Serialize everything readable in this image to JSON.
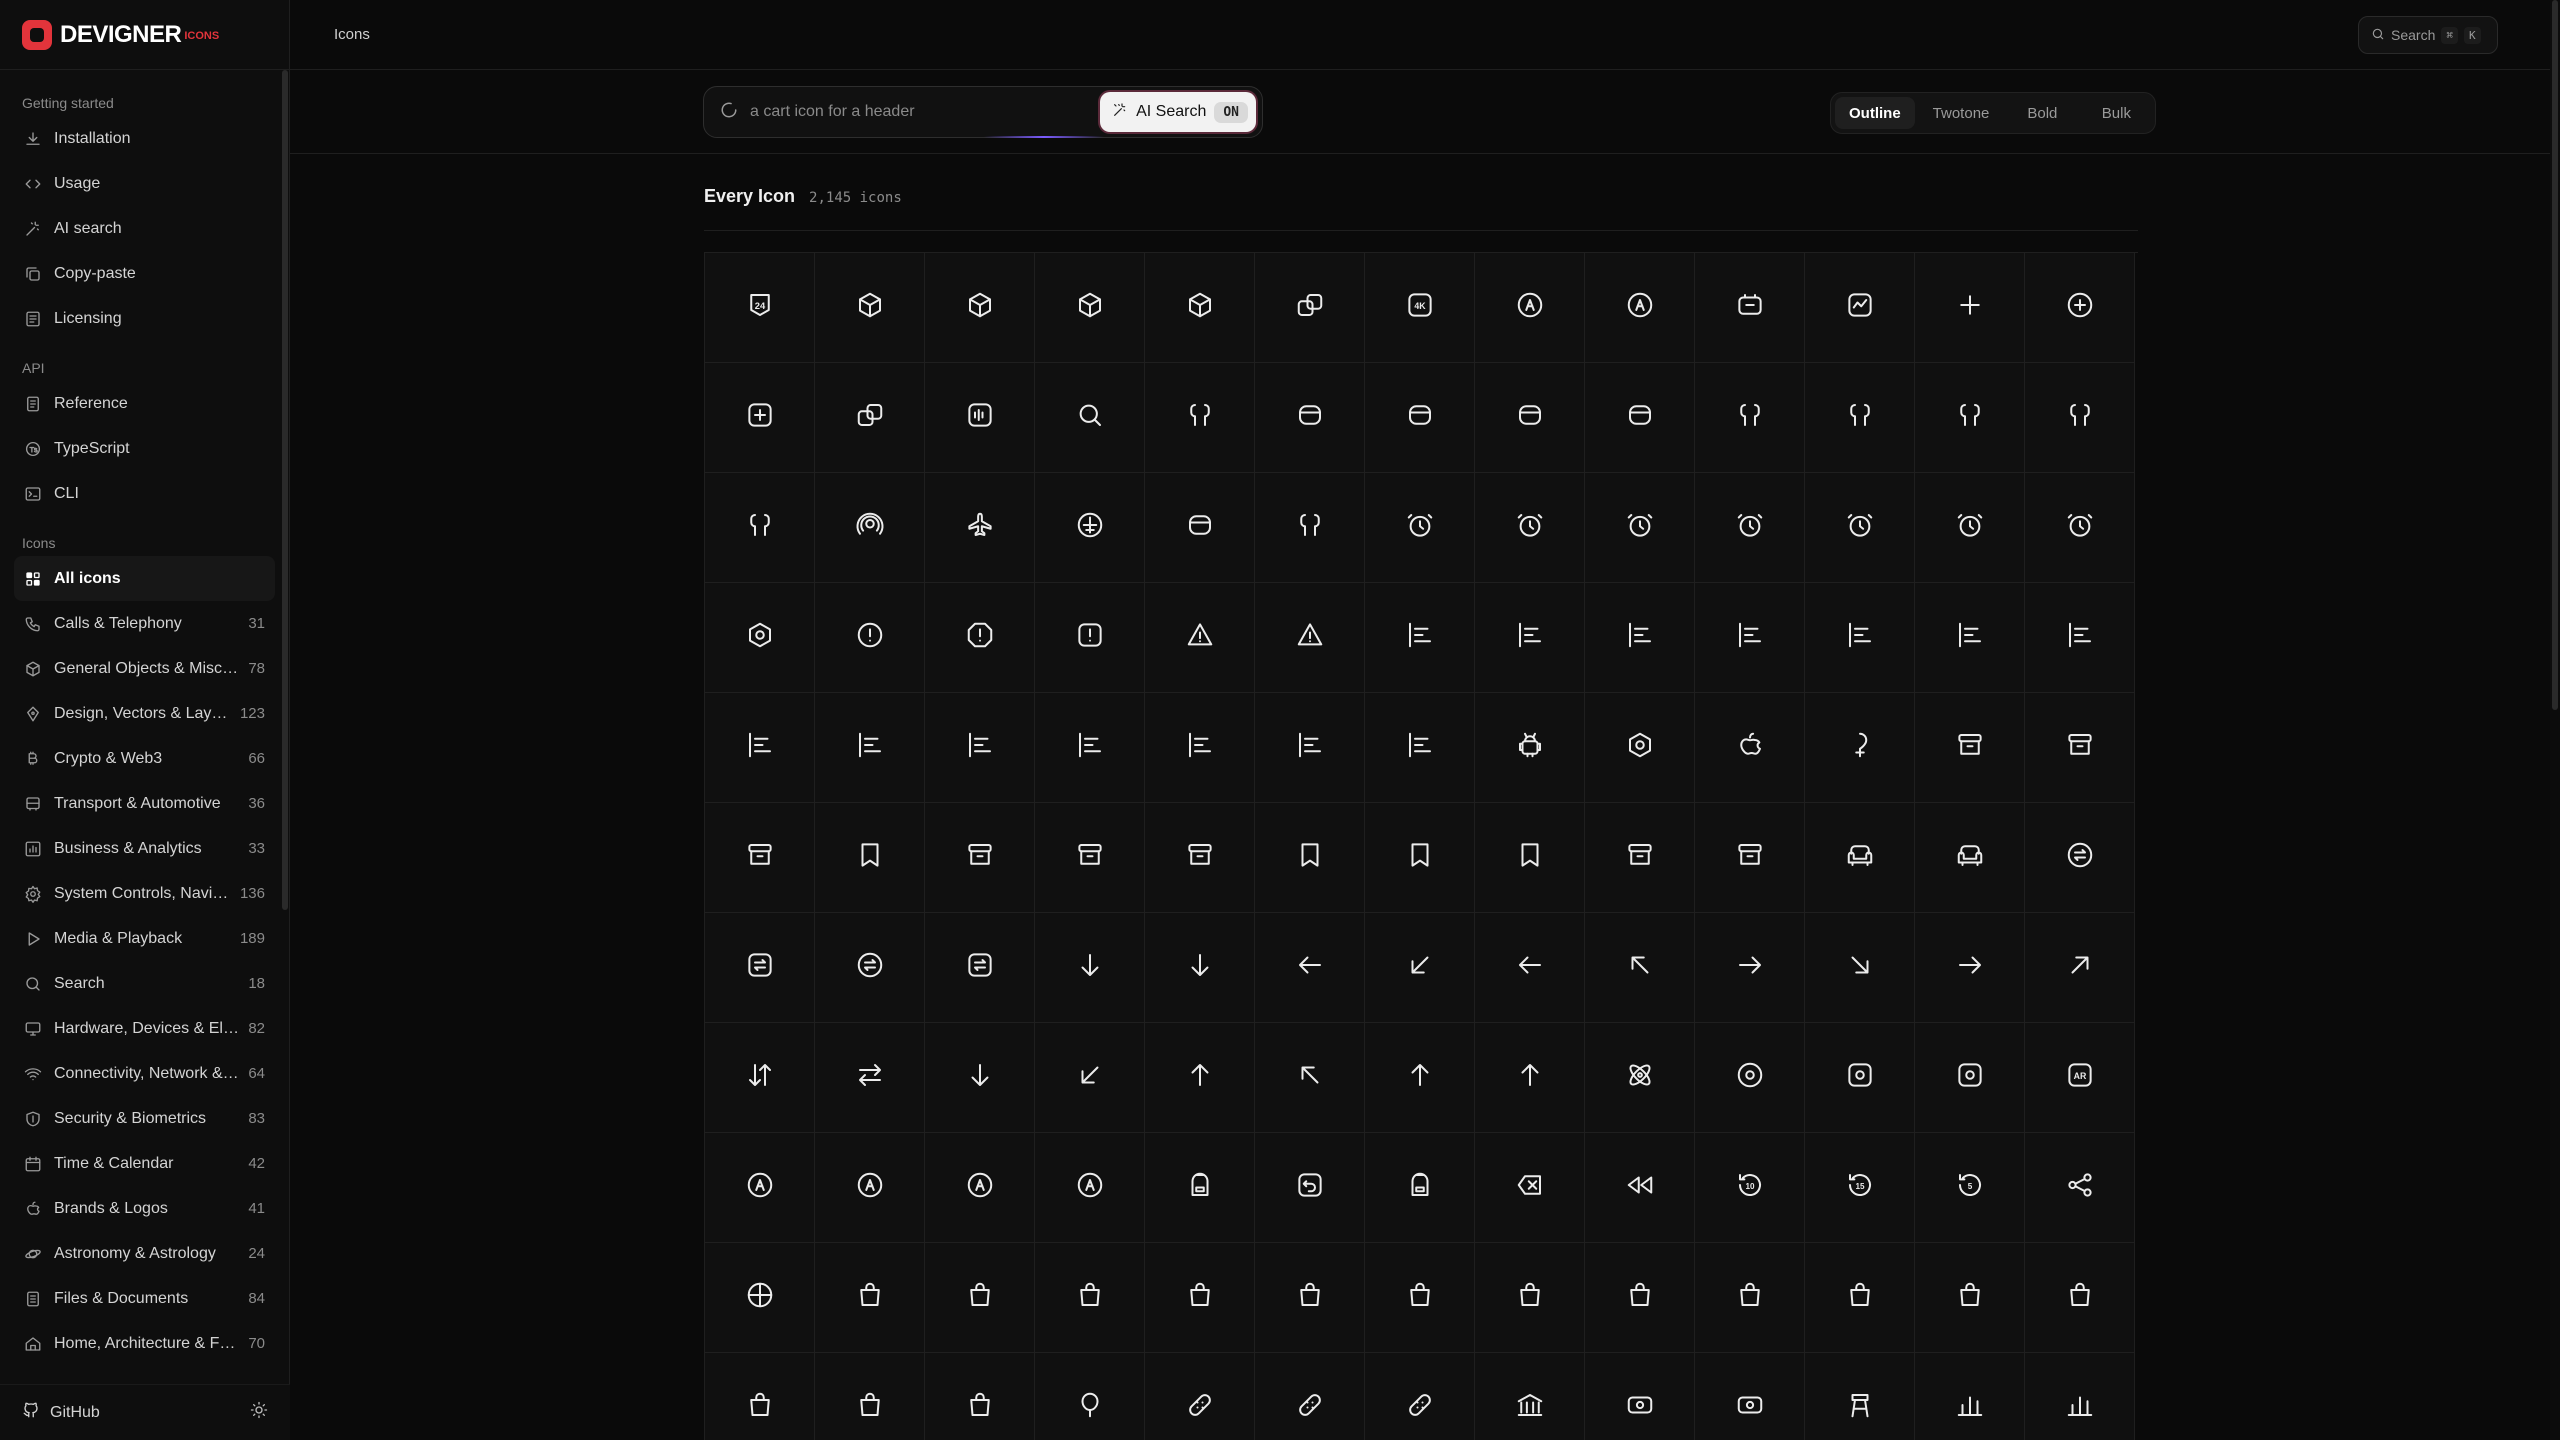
{
  "app": {
    "logo_text": "DEVIGNER",
    "logo_sub": "ICONS",
    "accent": "#e2343b"
  },
  "topbar": {
    "breadcrumb": "Icons",
    "search_label": "Search",
    "search_kbd_1": "⌘",
    "search_kbd_2": "K"
  },
  "sidebar": {
    "groups": [
      {
        "heading": "Getting started",
        "items": [
          {
            "label": "Installation",
            "icon": "download-icon"
          },
          {
            "label": "Usage",
            "icon": "code-icon"
          },
          {
            "label": "AI search",
            "icon": "sparkle-icon"
          },
          {
            "label": "Copy-paste",
            "icon": "copy-icon"
          },
          {
            "label": "Licensing",
            "icon": "license-icon"
          }
        ]
      },
      {
        "heading": "API",
        "items": [
          {
            "label": "Reference",
            "icon": "document-icon"
          },
          {
            "label": "TypeScript",
            "icon": "typescript-icon"
          },
          {
            "label": "CLI",
            "icon": "terminal-icon"
          }
        ]
      },
      {
        "heading": "Icons",
        "items": [
          {
            "label": "All icons",
            "icon": "grid-icon",
            "active": true
          },
          {
            "label": "Calls & Telephony",
            "count": "31",
            "icon": "phone-icon"
          },
          {
            "label": "General Objects & Miscellaneous",
            "count": "78",
            "icon": "box-icon"
          },
          {
            "label": "Design, Vectors & Layout",
            "count": "123",
            "icon": "pen-icon"
          },
          {
            "label": "Crypto & Web3",
            "count": "66",
            "icon": "bitcoin-icon"
          },
          {
            "label": "Transport & Automotive",
            "count": "36",
            "icon": "bus-icon"
          },
          {
            "label": "Business & Analytics",
            "count": "33",
            "icon": "chart-icon"
          },
          {
            "label": "System Controls, Navigation",
            "count": "136",
            "icon": "gear-icon"
          },
          {
            "label": "Media & Playback",
            "count": "189",
            "icon": "play-icon"
          },
          {
            "label": "Search",
            "count": "18",
            "icon": "search-icon"
          },
          {
            "label": "Hardware, Devices & Electronics",
            "count": "82",
            "icon": "monitor-icon"
          },
          {
            "label": "Connectivity, Network & Wireless",
            "count": "64",
            "icon": "wifi-icon"
          },
          {
            "label": "Security & Biometrics",
            "count": "83",
            "icon": "shield-icon"
          },
          {
            "label": "Time & Calendar",
            "count": "42",
            "icon": "calendar-icon"
          },
          {
            "label": "Brands & Logos",
            "count": "41",
            "icon": "apple-icon"
          },
          {
            "label": "Astronomy & Astrology",
            "count": "24",
            "icon": "planet-icon"
          },
          {
            "label": "Files & Documents",
            "count": "84",
            "icon": "file-icon"
          },
          {
            "label": "Home, Architecture & Furniture",
            "count": "70",
            "icon": "home-icon"
          }
        ]
      }
    ],
    "footer": {
      "label": "GitHub"
    }
  },
  "toolbar": {
    "ai_placeholder": "a cart icon for a header",
    "ai_button": "AI Search",
    "ai_state": "ON",
    "styles": [
      "Outline",
      "Twotone",
      "Bold",
      "Bulk"
    ],
    "selected_style": "Outline"
  },
  "section": {
    "title": "Every Icon",
    "count": "2,145 icons"
  },
  "icons": [
    "24-hours-icon",
    "cube-icon",
    "cube-rotate-icon",
    "cube-hexagon-icon",
    "box-3d-icon",
    "boxes-icon",
    "4k-icon",
    "accessibility-a-icon",
    "accessibility-icon",
    "camera-battery-icon",
    "activity-icon",
    "plus-icon",
    "plus-circle-icon",
    "plus-square-icon",
    "copy-plus-icon",
    "audio-sparkle-icon",
    "search-sparkle-icon",
    "airpods-icon",
    "airpods-case-icon",
    "airpods-case-charging-icon",
    "airpods-case-minus-icon",
    "airpods-box-icon",
    "airpods-left-icon",
    "airpods-right-icon",
    "airpods-battery-icon",
    "airpods-add-icon",
    "airpods-settings-icon",
    "airdrop-icon",
    "airplane-icon",
    "airplane-circle-icon",
    "airpods-pro-case-icon",
    "airpods-pro-icon",
    "alarm-clock-icon",
    "alarm-plus-icon",
    "alarm-pause-icon",
    "alarm-play-icon",
    "alarm-minus-icon",
    "alarm-snooze-icon",
    "alarm-off-icon",
    "album-icon",
    "alert-circle-icon",
    "alert-octagon-icon",
    "alert-square-icon",
    "alert-triangle-icon",
    "warning-icon",
    "align-bottom-icon",
    "align-bar-icon",
    "align-center-vertical-icon",
    "align-horizontal-space-icon",
    "align-center-horizontal-icon",
    "align-left-icon",
    "align-left-bars-icon",
    "align-right-icon",
    "align-right-bars-icon",
    "align-top-icon",
    "align-top-bars-icon",
    "align-vertical-center-icon",
    "align-vertical-space-icon",
    "align-middle-icon",
    "android-icon",
    "hexagon-target-icon",
    "apple-icon",
    "apple-pay-icon",
    "archive-icon",
    "archive-book-icon",
    "archive-list-icon",
    "bookmark-plus-icon",
    "archive-smile-icon",
    "archive-image-icon",
    "archive-down-icon",
    "bookmark-minus-icon",
    "bookmark-slash-icon",
    "bookmark-check-icon",
    "archive-up-icon",
    "archive-check-icon",
    "armchair-icon",
    "sofa-icon",
    "arrow-swap-circle-icon",
    "arrow-swap-square-icon",
    "arrow-up-down-circle-icon",
    "arrow-up-down-square-icon",
    "arrow-down-icon",
    "arrow-down-2-icon",
    "arrow-left-icon",
    "arrow-down-left-icon",
    "arrow-left-2-icon",
    "arrow-up-left-icon",
    "arrow-right-icon",
    "arrow-down-right-icon",
    "arrow-right-2-icon",
    "arrow-up-right-icon",
    "arrows-up-down-icon",
    "arrows-left-right-icon",
    "arrow-turn-down-icon",
    "arrow-turn-down-left-icon",
    "arrow-turn-up-icon",
    "arrow-turn-up-left-icon",
    "arrow-up-icon",
    "arrow-up-2-icon",
    "atom-icon",
    "at-sign-circle-icon",
    "at-sign-square-icon",
    "audio-square-icon",
    "ar-icon",
    "autodesk-icon",
    "badge-a-icon",
    "autocad-triangle-icon",
    "autocad-circle-icon",
    "backpack-icon",
    "back-square-icon",
    "backpack-2-icon",
    "backspace-icon",
    "rewind-icon",
    "rewind-10-icon",
    "rewind-15-icon",
    "rewind-5-icon",
    "share-nodes-icon",
    "ball-icon",
    "bag-icon",
    "bag-2-icon",
    "bag-3-icon",
    "bag-4-icon",
    "bag-5-icon",
    "bag-6-icon",
    "bag-check-icon",
    "bag-cross-icon",
    "bag-camera-icon",
    "bag-heart-icon",
    "bag-music-icon",
    "bag-tick-icon",
    "bag-smile-icon",
    "bag-lock-icon",
    "bag-lock-2-icon",
    "balloon-icon",
    "bandage-icon",
    "bandage-2-icon",
    "bandage-3-icon",
    "bank-icon",
    "banknote-icon",
    "banknote-2-icon",
    "bar-stool-icon",
    "bar-chart-icon",
    "bar-chart-2-icon"
  ]
}
